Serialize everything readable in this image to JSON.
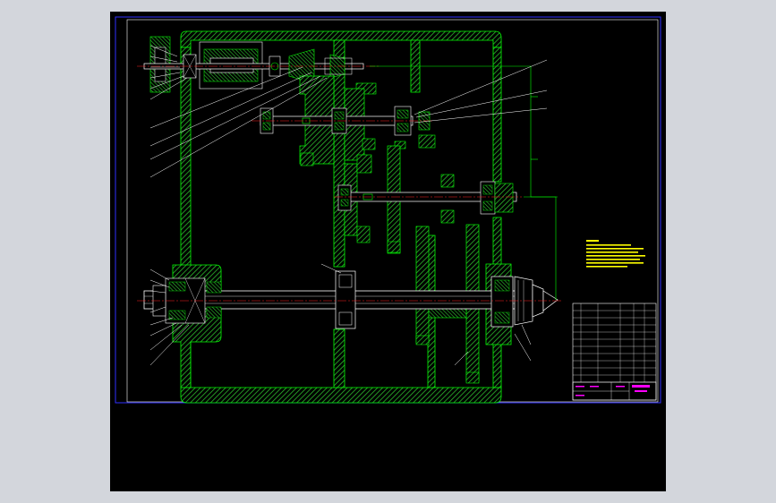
{
  "colors": {
    "background": "#000000",
    "viewer": "#d3d6dc",
    "frame": "#ffffff",
    "outer_border": "#3030ff",
    "housing": "#00ff00",
    "center_line": "#ff2020",
    "shaft": "#ffffff",
    "leader": "#ffffff",
    "notes": "#ffff00",
    "title_block": "#ff00ff"
  },
  "icons": {
    "chuck": "chuck-icon",
    "bearing": "bearing-icon",
    "gear": "gear-icon"
  }
}
